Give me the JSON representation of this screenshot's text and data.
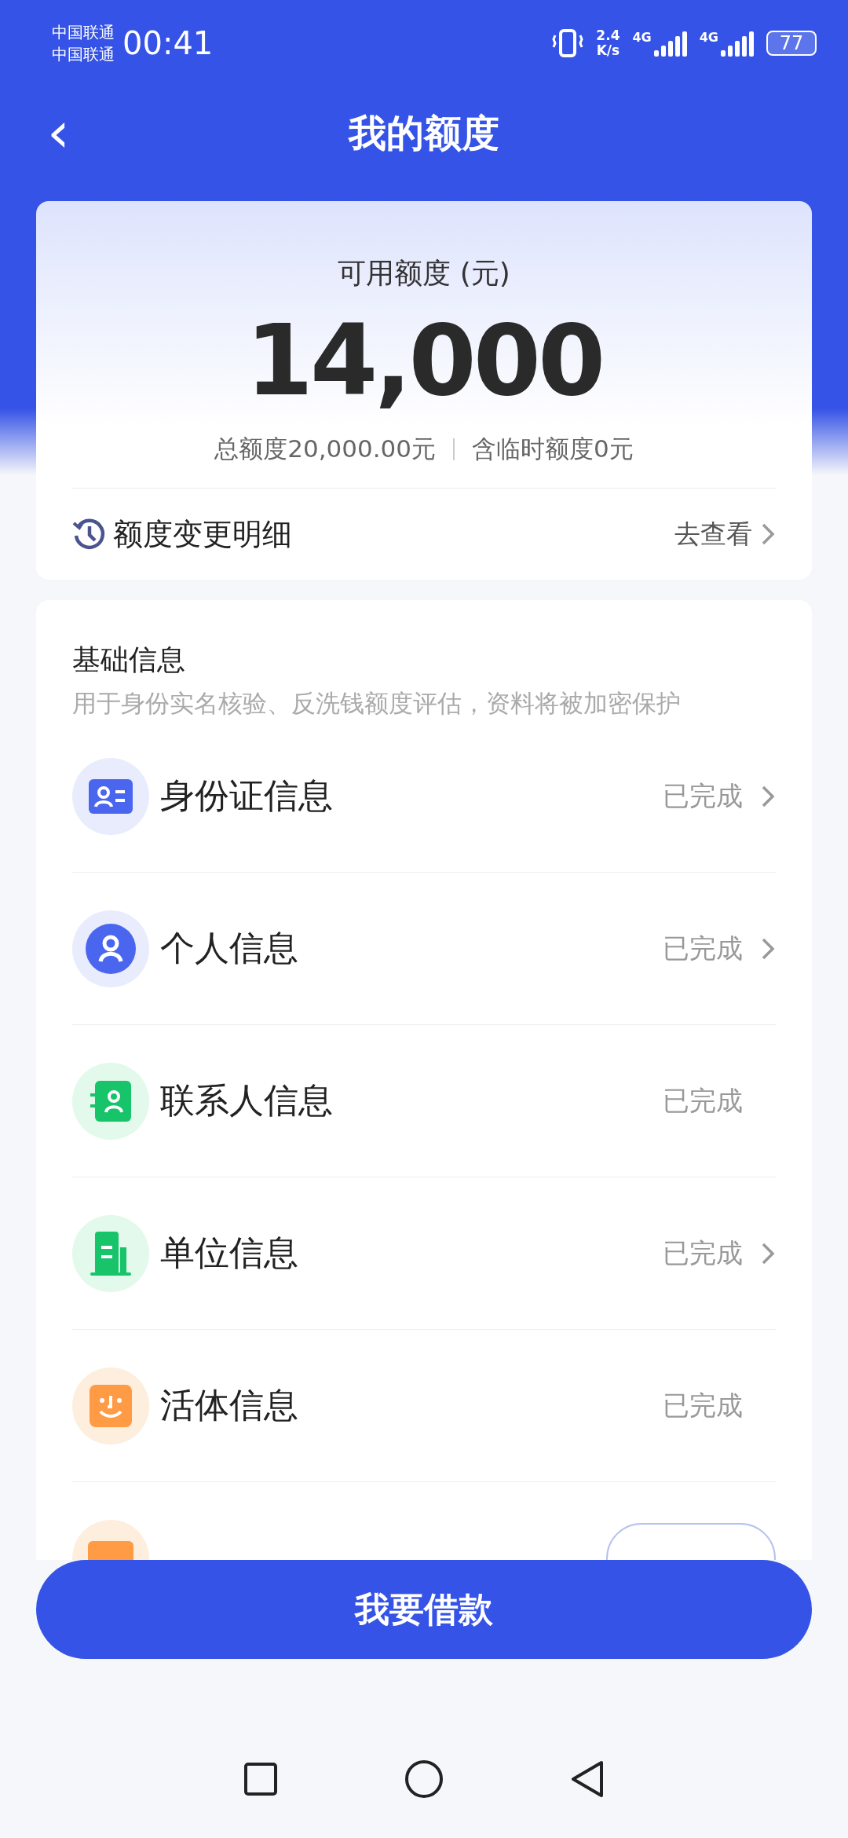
{
  "status_bar": {
    "carriers": [
      "中国联通",
      "中国联通"
    ],
    "time": "00:41",
    "speed": [
      "2.4",
      "K/s"
    ],
    "networks": [
      "4G",
      "4G"
    ],
    "battery": "77"
  },
  "header": {
    "back": "‹",
    "title": "我的额度"
  },
  "quota": {
    "label": "可用额度 (元)",
    "amount": "14,000",
    "total": "总额度20,000.00元",
    "temporary": "含临时额度0元",
    "detail_label": "额度变更明细",
    "detail_link": "去查看"
  },
  "basic_info": {
    "title": "基础信息",
    "description": "用于身份实名核验、反洗钱额度评估，资料将被加密保护",
    "items": [
      {
        "kind": "id-card",
        "label": "身份证信息",
        "status": "已完成",
        "chevron": true
      },
      {
        "kind": "person",
        "label": "个人信息",
        "status": "已完成",
        "chevron": true
      },
      {
        "kind": "contact",
        "label": "联系人信息",
        "status": "已完成",
        "chevron": false
      },
      {
        "kind": "building",
        "label": "单位信息",
        "status": "已完成",
        "chevron": true
      },
      {
        "kind": "face",
        "label": "活体信息",
        "status": "已完成",
        "chevron": false
      },
      {
        "kind": "bank"
      }
    ]
  },
  "primary_button": "我要借款"
}
